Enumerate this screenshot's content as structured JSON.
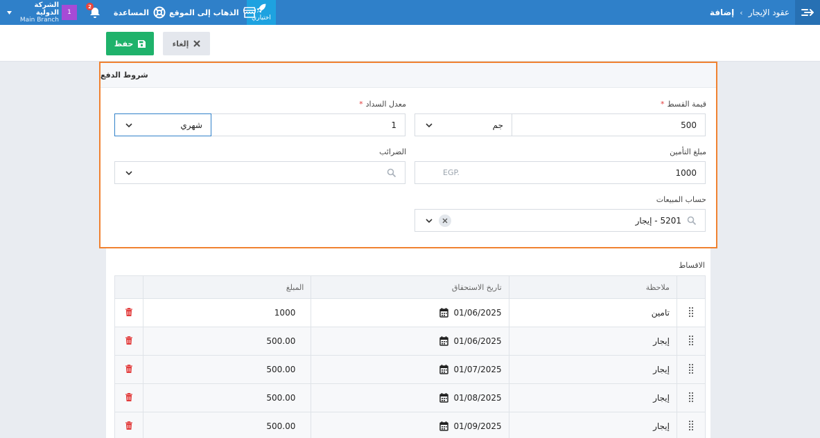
{
  "topbar": {
    "breadcrumb": {
      "parent": "عقود الإيجار",
      "separator": "›",
      "current": "إضافة"
    },
    "shortcut_tab": "اختياري",
    "go_to_site": "الذهاب إلى الموقع",
    "help": "المساعدة",
    "notification_count": "2",
    "avatar_text": "1",
    "company_name": "الشركة الدولية",
    "branch_name": "Main Branch"
  },
  "actions": {
    "save_label": "حفظ",
    "cancel_label": "إلغاء"
  },
  "payment_terms": {
    "title": "شروط الدفع",
    "installment_value": {
      "label": "قيمة القسط",
      "value": "500",
      "currency": "جم"
    },
    "payment_rate": {
      "label": "معدل السداد",
      "count": "1",
      "period": "شهري"
    },
    "insurance_amount": {
      "label": "مبلغ التأمين",
      "value": "1000",
      "suffix": "EGP."
    },
    "taxes": {
      "label": "الضرائب",
      "value": ""
    },
    "sales_account": {
      "label": "حساب المبيعات",
      "value": "5201 - إيجار"
    }
  },
  "installments": {
    "title": "الاقساط",
    "columns": {
      "note": "ملاحظة",
      "due_date": "تاريخ الاستحقاق",
      "amount": "المبلغ"
    },
    "rows": [
      {
        "note": "تامين",
        "due_date": "01/06/2025",
        "amount": "1000"
      },
      {
        "note": "إيجار",
        "due_date": "01/06/2025",
        "amount": "500.00"
      },
      {
        "note": "إيجار",
        "due_date": "01/07/2025",
        "amount": "500.00"
      },
      {
        "note": "إيجار",
        "due_date": "01/08/2025",
        "amount": "500.00"
      },
      {
        "note": "إيجار",
        "due_date": "01/09/2025",
        "amount": "500.00"
      }
    ]
  },
  "icons": {
    "menu": "arrow-collapse-icon",
    "rocket": "rocket-icon",
    "store": "store-icon",
    "lifebuoy": "lifebuoy-icon",
    "bell": "bell-icon",
    "save": "floppy-icon",
    "cancel": "x-icon",
    "search": "search-icon",
    "calendar": "calendar-icon",
    "trash": "trash-icon",
    "drag": "drag-handle-icon"
  },
  "colors": {
    "topbar": "#2f80c9",
    "save": "#1fb26b",
    "highlight": "#f0812f",
    "delete": "#e23b3b",
    "avatar": "#a64bd6"
  }
}
